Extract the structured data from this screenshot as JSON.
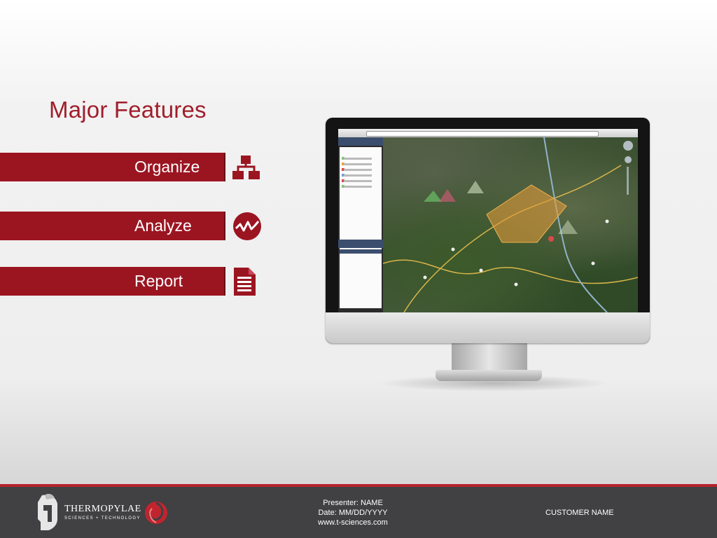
{
  "slide": {
    "title": "Major Features"
  },
  "features": [
    {
      "label": "Organize",
      "icon": "hierarchy-icon"
    },
    {
      "label": "Analyze",
      "icon": "trend-line-icon"
    },
    {
      "label": "Report",
      "icon": "document-icon"
    }
  ],
  "footer": {
    "logo_text": "THERMOPYLAE",
    "logo_subtext": "SCIENCES + TECHNOLOGY",
    "presenter_line": "Presenter: NAME",
    "date_line": "Date: MM/DD/YYYY",
    "website": "www.t-sciences.com",
    "customer": "CUSTOMER NAME"
  },
  "colors": {
    "accent": "#9b1521",
    "title": "#a01e2b",
    "footer_bg": "#414042",
    "footer_line": "#b5242e"
  }
}
